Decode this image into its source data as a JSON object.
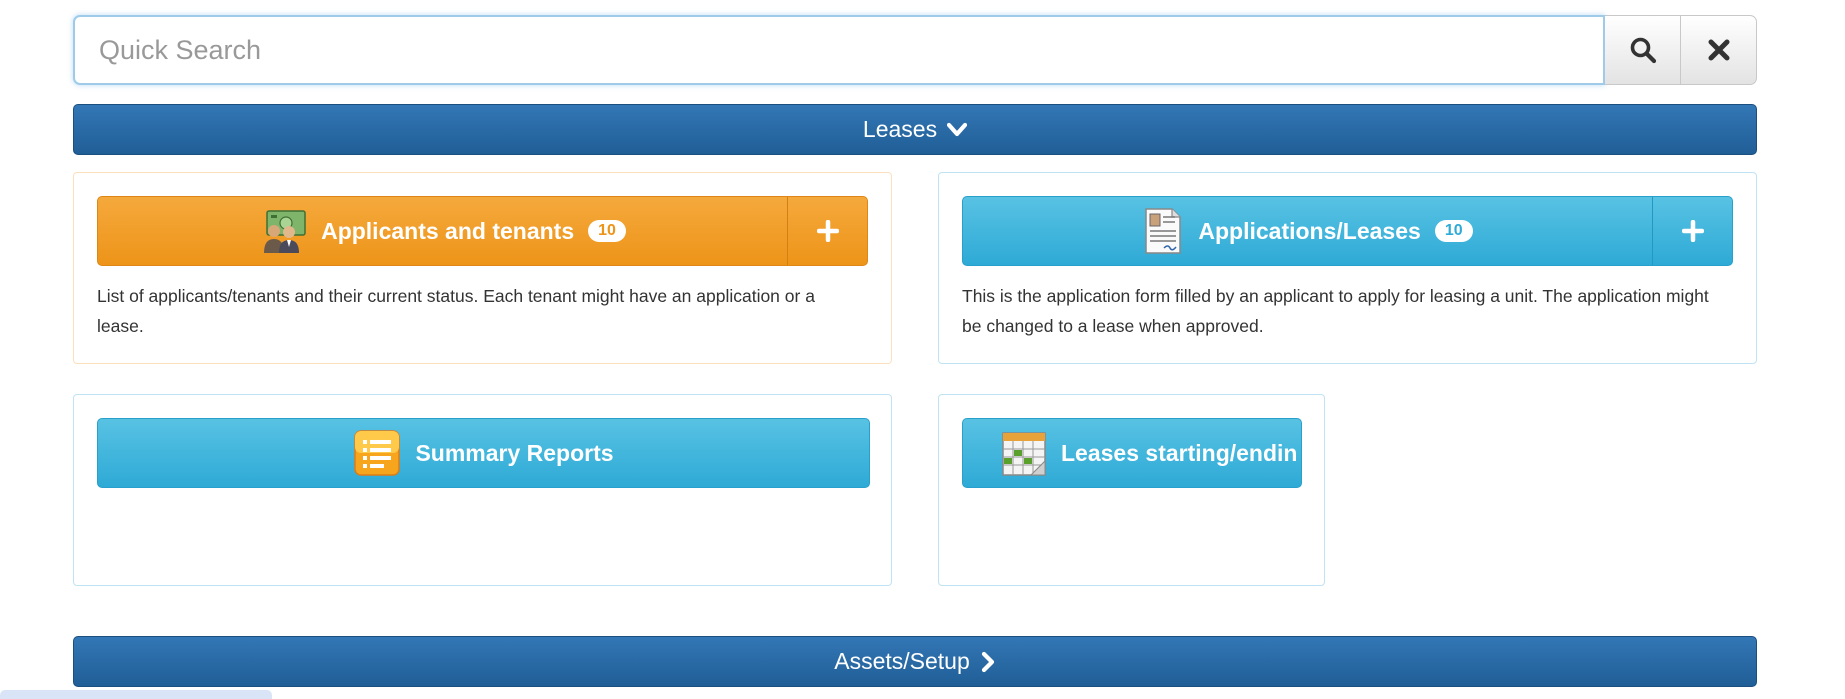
{
  "search": {
    "placeholder": "Quick Search",
    "search_icon": "magnifier-icon",
    "clear_icon": "close-icon"
  },
  "sections": {
    "leases": {
      "label": "Leases",
      "icon": "chevron-down-icon"
    },
    "assets": {
      "label": "Assets/Setup",
      "icon": "chevron-right-icon"
    }
  },
  "cards": [
    {
      "title": "Applicants and tenants",
      "count": "10",
      "icon": "tenants-money-icon",
      "add_icon": "plus-icon",
      "description": "List of applicants/tenants and their current status. Each tenant might have an application or a lease.",
      "color": "#ed9419"
    },
    {
      "title": "Applications/Leases",
      "count": "10",
      "icon": "application-form-icon",
      "add_icon": "plus-icon",
      "description": "This is the application form filled by an applicant to apply for leasing a unit. The application might be changed to a lease when approved.",
      "color": "#2eaad6"
    },
    {
      "title": "Summary Reports",
      "icon": "report-list-icon",
      "color": "#2eaad6"
    },
    {
      "title": "Leases starting/endin",
      "icon": "calendar-grid-icon",
      "color": "#2eaad6"
    }
  ],
  "colors": {
    "header_blue": "#2a6aa6",
    "accent_orange": "#ed9419",
    "accent_blue": "#2eaad6"
  }
}
